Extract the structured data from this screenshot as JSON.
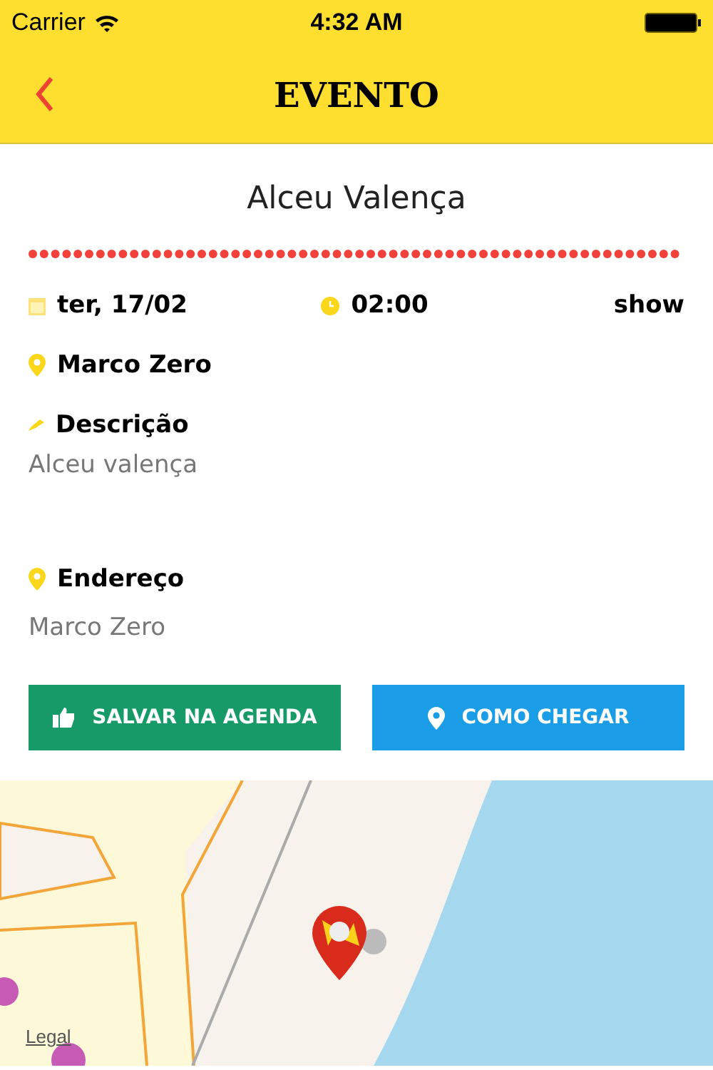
{
  "status_bar": {
    "carrier": "Carrier",
    "time": "4:32 AM"
  },
  "nav": {
    "title": "EVENTO"
  },
  "event": {
    "name": "Alceu Valença",
    "date": "ter, 17/02",
    "time": "02:00",
    "category": "show",
    "place": "Marco Zero",
    "description_label": "Descrição",
    "description": "Alceu valença",
    "address_label": "Endereço",
    "address": "Marco Zero"
  },
  "buttons": [
    {
      "label": "SALVAR NA AGENDA",
      "kind": "save"
    },
    {
      "label": "COMO CHEGAR",
      "kind": "directions"
    }
  ],
  "map": {
    "kind": "picture",
    "legal": "Legal"
  }
}
